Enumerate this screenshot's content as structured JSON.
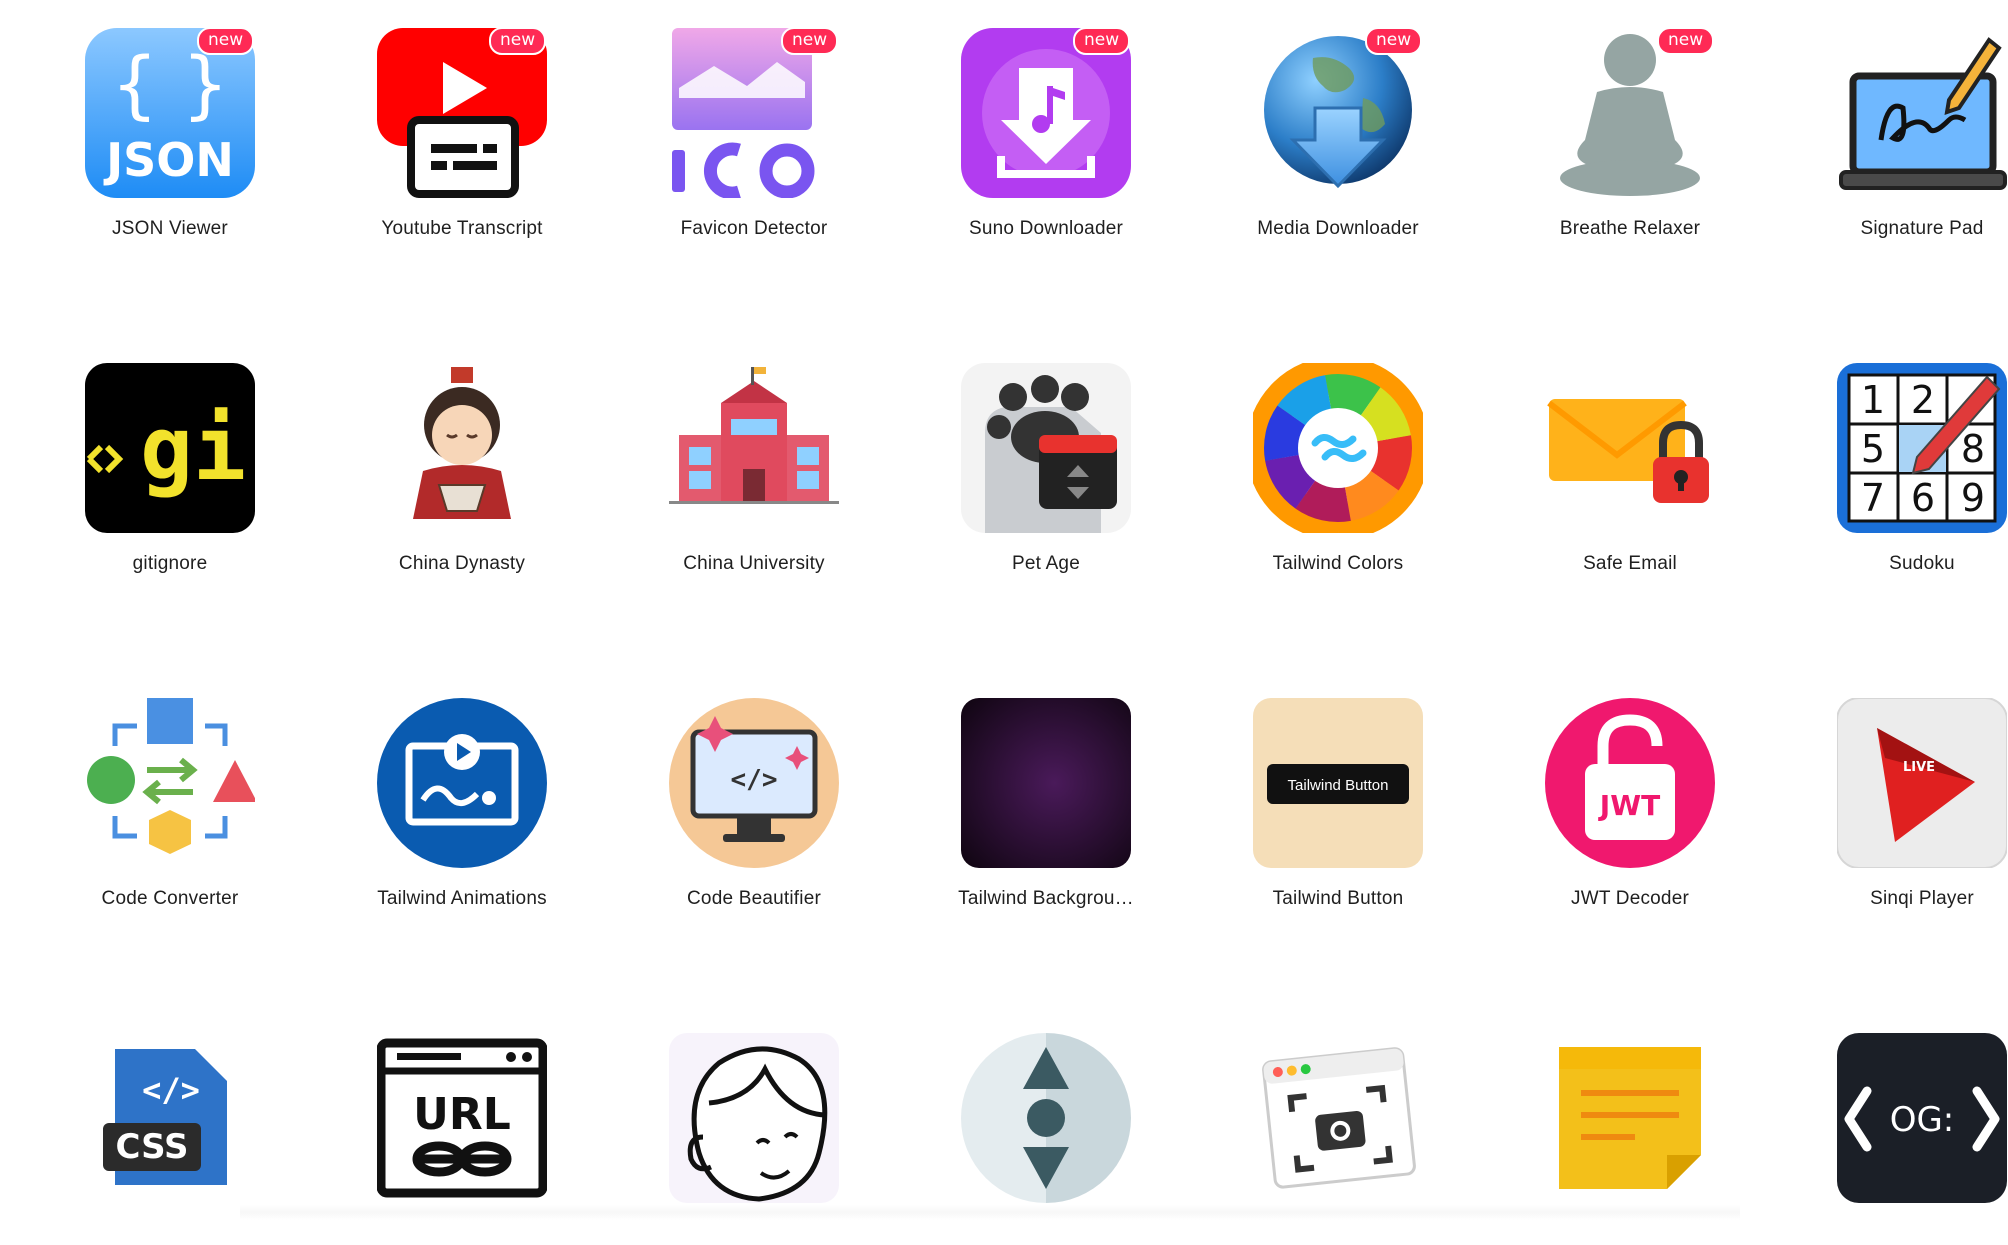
{
  "colors": {
    "badge": "#ff2a55",
    "label": "#1f1f1f",
    "background": "#ffffff"
  },
  "badge_text": "new",
  "apps": [
    [
      {
        "label": "JSON Viewer",
        "icon": "json-icon",
        "new": true
      },
      {
        "label": "Youtube Transcript",
        "icon": "youtube-transcript-icon",
        "new": true
      },
      {
        "label": "Favicon Detector",
        "icon": "favicon-ico-icon",
        "new": true
      },
      {
        "label": "Suno Downloader",
        "icon": "music-download-icon",
        "new": true
      },
      {
        "label": "Media Downloader",
        "icon": "globe-download-icon",
        "new": true
      },
      {
        "label": "Breathe Relaxer",
        "icon": "meditation-icon",
        "new": true
      },
      {
        "label": "Signature Pad",
        "icon": "laptop-signature-icon",
        "new": false
      }
    ],
    [
      {
        "label": "gitignore",
        "icon": "gitignore-icon",
        "new": false
      },
      {
        "label": "China Dynasty",
        "icon": "emperor-icon",
        "new": false
      },
      {
        "label": "China University",
        "icon": "university-building-icon",
        "new": false
      },
      {
        "label": "Pet Age",
        "icon": "paw-calendar-icon",
        "new": false
      },
      {
        "label": "Tailwind Colors",
        "icon": "color-wheel-icon",
        "new": false
      },
      {
        "label": "Safe Email",
        "icon": "envelope-lock-icon",
        "new": false
      },
      {
        "label": "Sudoku",
        "icon": "sudoku-grid-icon",
        "new": false
      }
    ],
    [
      {
        "label": "Code Converter",
        "icon": "shapes-convert-icon",
        "new": false
      },
      {
        "label": "Tailwind Animations",
        "icon": "animation-play-icon",
        "new": false
      },
      {
        "label": "Code Beautifier",
        "icon": "monitor-code-icon",
        "new": false
      },
      {
        "label": "Tailwind Backgrou…",
        "icon": "dark-gradient-icon",
        "new": false
      },
      {
        "label": "Tailwind Button",
        "icon": "button-preview-icon",
        "new": false,
        "inner_text": "Tailwind Button"
      },
      {
        "label": "JWT Decoder",
        "icon": "unlock-jwt-icon",
        "new": false,
        "inner_text": "JWT"
      },
      {
        "label": "Sinqi Player",
        "icon": "live-play-icon",
        "new": false,
        "inner_text": "LIVE"
      }
    ],
    [
      {
        "label": "",
        "icon": "css-file-icon",
        "new": false,
        "inner_text": "CSS"
      },
      {
        "label": "",
        "icon": "url-link-icon",
        "new": false,
        "inner_text": "URL"
      },
      {
        "label": "",
        "icon": "face-sketch-icon",
        "new": false
      },
      {
        "label": "",
        "icon": "sort-arrows-icon",
        "new": false
      },
      {
        "label": "",
        "icon": "screenshot-camera-icon",
        "new": false
      },
      {
        "label": "",
        "icon": "sticky-note-icon",
        "new": false
      },
      {
        "label": "",
        "icon": "og-tag-icon",
        "new": false,
        "inner_text": "OG:"
      }
    ]
  ]
}
